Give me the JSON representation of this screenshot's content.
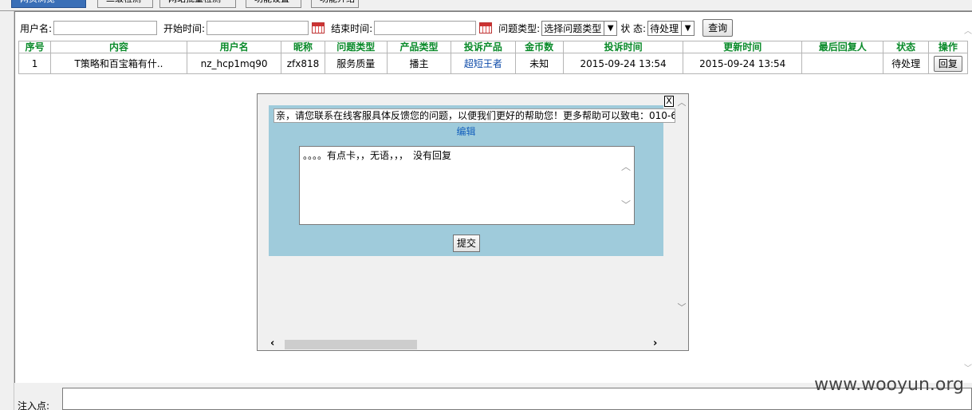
{
  "tabs": [
    "网页浏览",
    "二级检测",
    "网站批量检测",
    "功能设置",
    "功能介绍"
  ],
  "filter": {
    "username_label": "用户名:",
    "start_time_label": "开始时间:",
    "end_time_label": "结束时间:",
    "issue_type_label": "问题类型:",
    "issue_type_value": "选择问题类型",
    "status_label": "状 态:",
    "status_value": "待处理",
    "query_button": "查询"
  },
  "table": {
    "headers": [
      "序号",
      "内容",
      "用户名",
      "昵称",
      "问题类型",
      "产品类型",
      "投诉产品",
      "金币数",
      "投诉时间",
      "更新时间",
      "最后回复人",
      "状态",
      "操作"
    ],
    "rows": [
      [
        "1",
        "T策略和百宝箱有什..",
        "nz_hcp1mq90",
        "zfx818",
        "服务质量",
        "播主",
        "超短王者",
        "未知",
        "2015-09-24 13:54",
        "2015-09-24 13:54",
        "",
        "待处理",
        "回复"
      ]
    ]
  },
  "popup": {
    "close_label": "X",
    "notice": "亲，请您联系在线客服具体反馈您的问题，以便我们更好的帮助您！更多帮助可以致电：010-6",
    "edit_label": "编辑",
    "reply_text": "。。。。有点卡，，无语，，，　没有回复",
    "submit_label": "提交"
  },
  "bottom": {
    "label": "注入点:"
  },
  "watermark": "www.wooyun.org"
}
